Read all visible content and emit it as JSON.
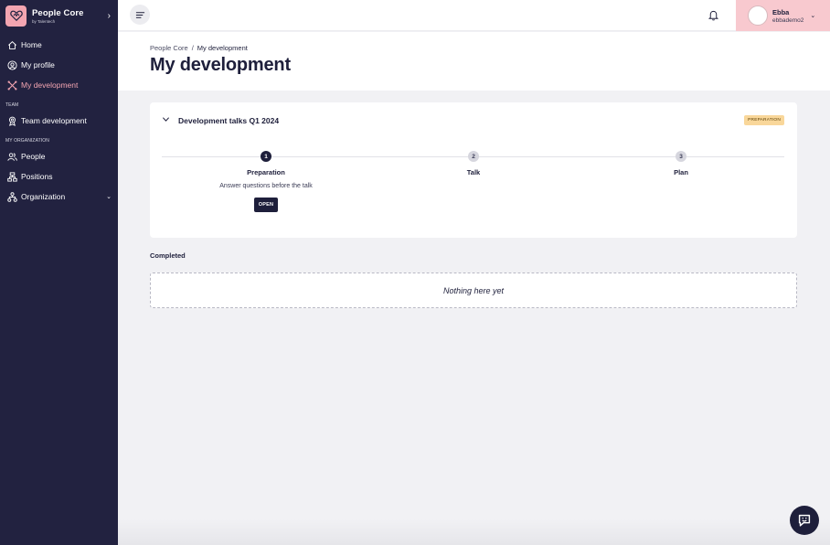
{
  "brand": {
    "name": "People Core",
    "sub": "by Talentech",
    "color": "#f3a5b1"
  },
  "sidebar": {
    "items": [
      {
        "label": "Home",
        "icon": "home-icon"
      },
      {
        "label": "My profile",
        "icon": "profile-icon"
      },
      {
        "label": "My development",
        "icon": "development-icon",
        "active": true
      }
    ],
    "team_label": "TEAM",
    "team_items": [
      {
        "label": "Team development",
        "icon": "award-icon"
      }
    ],
    "org_label": "MY ORGANIZATION",
    "org_items": [
      {
        "label": "People",
        "icon": "people-icon"
      },
      {
        "label": "Positions",
        "icon": "positions-icon"
      },
      {
        "label": "Organization",
        "icon": "organization-icon",
        "expandable": true
      }
    ]
  },
  "user": {
    "name": "Ebba",
    "handle": "ebbademo2"
  },
  "breadcrumb": {
    "root": "People Core",
    "separator": "/",
    "current": "My development"
  },
  "page": {
    "title": "My development"
  },
  "talk": {
    "title": "Development talks Q1 2024",
    "status": "PREPARATION",
    "steps": [
      {
        "num": "1",
        "label": "Preparation",
        "desc": "Answer questions before the talk",
        "action": "OPEN"
      },
      {
        "num": "2",
        "label": "Talk"
      },
      {
        "num": "3",
        "label": "Plan"
      }
    ]
  },
  "completed": {
    "label": "Completed",
    "empty_text": "Nothing here yet"
  },
  "colors": {
    "sidebar_bg": "#222240",
    "accent_pink": "#f3a5b1",
    "badge_bg": "#f9d79a"
  }
}
